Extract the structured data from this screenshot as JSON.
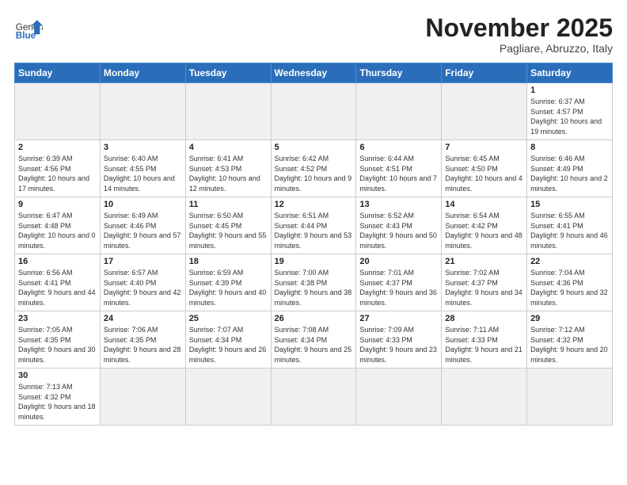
{
  "header": {
    "logo_general": "General",
    "logo_blue": "Blue",
    "month_title": "November 2025",
    "subtitle": "Pagliare, Abruzzo, Italy"
  },
  "weekdays": [
    "Sunday",
    "Monday",
    "Tuesday",
    "Wednesday",
    "Thursday",
    "Friday",
    "Saturday"
  ],
  "weeks": [
    [
      {
        "day": "",
        "empty": true
      },
      {
        "day": "",
        "empty": true
      },
      {
        "day": "",
        "empty": true
      },
      {
        "day": "",
        "empty": true
      },
      {
        "day": "",
        "empty": true
      },
      {
        "day": "",
        "empty": true
      },
      {
        "day": "1",
        "info": "Sunrise: 6:37 AM\nSunset: 4:57 PM\nDaylight: 10 hours and 19 minutes."
      }
    ],
    [
      {
        "day": "2",
        "info": "Sunrise: 6:39 AM\nSunset: 4:56 PM\nDaylight: 10 hours and 17 minutes."
      },
      {
        "day": "3",
        "info": "Sunrise: 6:40 AM\nSunset: 4:55 PM\nDaylight: 10 hours and 14 minutes."
      },
      {
        "day": "4",
        "info": "Sunrise: 6:41 AM\nSunset: 4:53 PM\nDaylight: 10 hours and 12 minutes."
      },
      {
        "day": "5",
        "info": "Sunrise: 6:42 AM\nSunset: 4:52 PM\nDaylight: 10 hours and 9 minutes."
      },
      {
        "day": "6",
        "info": "Sunrise: 6:44 AM\nSunset: 4:51 PM\nDaylight: 10 hours and 7 minutes."
      },
      {
        "day": "7",
        "info": "Sunrise: 6:45 AM\nSunset: 4:50 PM\nDaylight: 10 hours and 4 minutes."
      },
      {
        "day": "8",
        "info": "Sunrise: 6:46 AM\nSunset: 4:49 PM\nDaylight: 10 hours and 2 minutes."
      }
    ],
    [
      {
        "day": "9",
        "info": "Sunrise: 6:47 AM\nSunset: 4:48 PM\nDaylight: 10 hours and 0 minutes."
      },
      {
        "day": "10",
        "info": "Sunrise: 6:49 AM\nSunset: 4:46 PM\nDaylight: 9 hours and 57 minutes."
      },
      {
        "day": "11",
        "info": "Sunrise: 6:50 AM\nSunset: 4:45 PM\nDaylight: 9 hours and 55 minutes."
      },
      {
        "day": "12",
        "info": "Sunrise: 6:51 AM\nSunset: 4:44 PM\nDaylight: 9 hours and 53 minutes."
      },
      {
        "day": "13",
        "info": "Sunrise: 6:52 AM\nSunset: 4:43 PM\nDaylight: 9 hours and 50 minutes."
      },
      {
        "day": "14",
        "info": "Sunrise: 6:54 AM\nSunset: 4:42 PM\nDaylight: 9 hours and 48 minutes."
      },
      {
        "day": "15",
        "info": "Sunrise: 6:55 AM\nSunset: 4:41 PM\nDaylight: 9 hours and 46 minutes."
      }
    ],
    [
      {
        "day": "16",
        "info": "Sunrise: 6:56 AM\nSunset: 4:41 PM\nDaylight: 9 hours and 44 minutes."
      },
      {
        "day": "17",
        "info": "Sunrise: 6:57 AM\nSunset: 4:40 PM\nDaylight: 9 hours and 42 minutes."
      },
      {
        "day": "18",
        "info": "Sunrise: 6:59 AM\nSunset: 4:39 PM\nDaylight: 9 hours and 40 minutes."
      },
      {
        "day": "19",
        "info": "Sunrise: 7:00 AM\nSunset: 4:38 PM\nDaylight: 9 hours and 38 minutes."
      },
      {
        "day": "20",
        "info": "Sunrise: 7:01 AM\nSunset: 4:37 PM\nDaylight: 9 hours and 36 minutes."
      },
      {
        "day": "21",
        "info": "Sunrise: 7:02 AM\nSunset: 4:37 PM\nDaylight: 9 hours and 34 minutes."
      },
      {
        "day": "22",
        "info": "Sunrise: 7:04 AM\nSunset: 4:36 PM\nDaylight: 9 hours and 32 minutes."
      }
    ],
    [
      {
        "day": "23",
        "info": "Sunrise: 7:05 AM\nSunset: 4:35 PM\nDaylight: 9 hours and 30 minutes."
      },
      {
        "day": "24",
        "info": "Sunrise: 7:06 AM\nSunset: 4:35 PM\nDaylight: 9 hours and 28 minutes."
      },
      {
        "day": "25",
        "info": "Sunrise: 7:07 AM\nSunset: 4:34 PM\nDaylight: 9 hours and 26 minutes."
      },
      {
        "day": "26",
        "info": "Sunrise: 7:08 AM\nSunset: 4:34 PM\nDaylight: 9 hours and 25 minutes."
      },
      {
        "day": "27",
        "info": "Sunrise: 7:09 AM\nSunset: 4:33 PM\nDaylight: 9 hours and 23 minutes."
      },
      {
        "day": "28",
        "info": "Sunrise: 7:11 AM\nSunset: 4:33 PM\nDaylight: 9 hours and 21 minutes."
      },
      {
        "day": "29",
        "info": "Sunrise: 7:12 AM\nSunset: 4:32 PM\nDaylight: 9 hours and 20 minutes."
      }
    ],
    [
      {
        "day": "30",
        "info": "Sunrise: 7:13 AM\nSunset: 4:32 PM\nDaylight: 9 hours and 18 minutes."
      },
      {
        "day": "",
        "empty": true
      },
      {
        "day": "",
        "empty": true
      },
      {
        "day": "",
        "empty": true
      },
      {
        "day": "",
        "empty": true
      },
      {
        "day": "",
        "empty": true
      },
      {
        "day": "",
        "empty": true
      }
    ]
  ]
}
